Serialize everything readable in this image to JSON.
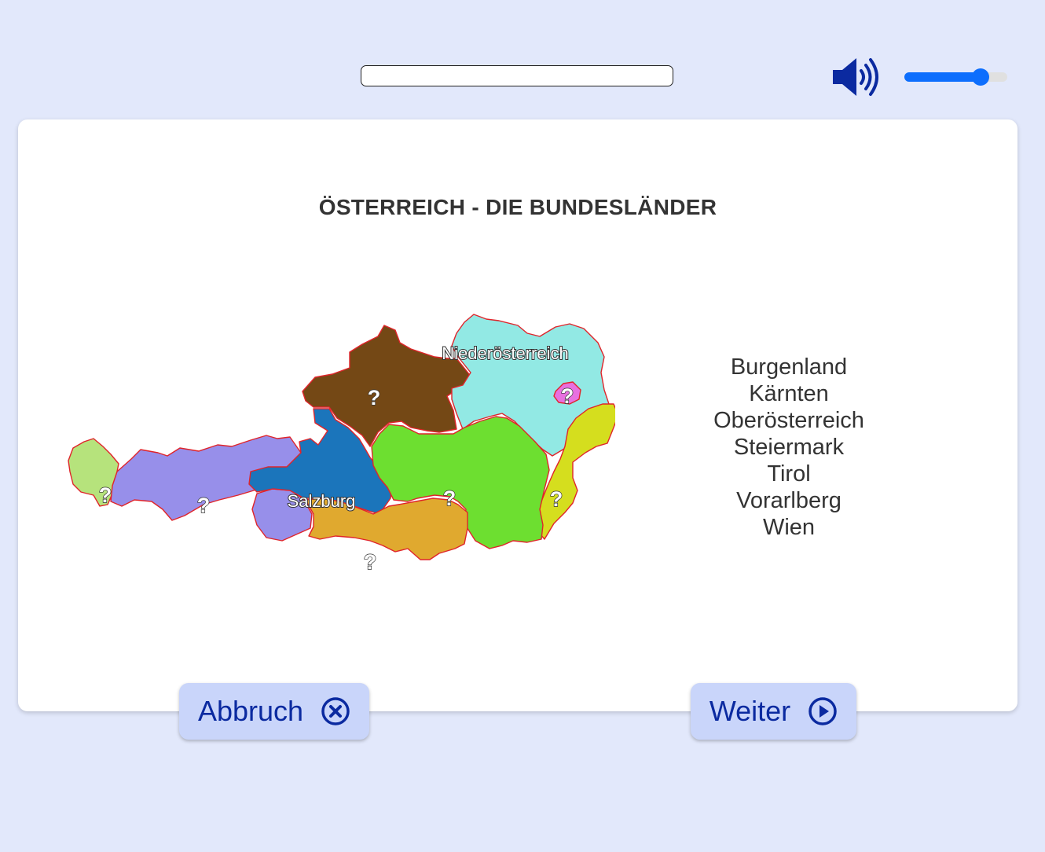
{
  "quiz": {
    "title": "ÖSTERREICH - DIE BUNDESLÄNDER",
    "progress": 0,
    "volume": 0.74
  },
  "map": {
    "placed_labels": [
      "Niederösterreich",
      "Salzburg"
    ],
    "question_mark": "?"
  },
  "names": [
    "Burgenland",
    "Kärnten",
    "Oberösterreich",
    "Steiermark",
    "Tirol",
    "Vorarlberg",
    "Wien"
  ],
  "buttons": {
    "cancel_label": "Abbruch",
    "next_label": "Weiter"
  },
  "icons": {
    "speaker": "speaker-icon",
    "cancel": "circle-x-icon",
    "next": "circle-play-icon"
  },
  "colors": {
    "vorarlberg": "#b6e37c",
    "tirol": "#978fea",
    "salzburg": "#1b75bb",
    "oberoesterreich": "#744815",
    "niederoesterreich": "#92e9e4",
    "wien": "#e870e0",
    "burgenland": "#d5de1e",
    "steiermark": "#6ddf30",
    "kaernten": "#e0a92f",
    "border": "#e0242a",
    "accent": "#0d6efd",
    "button_bg": "#c9d5fa",
    "button_text": "#0b2aa0"
  }
}
